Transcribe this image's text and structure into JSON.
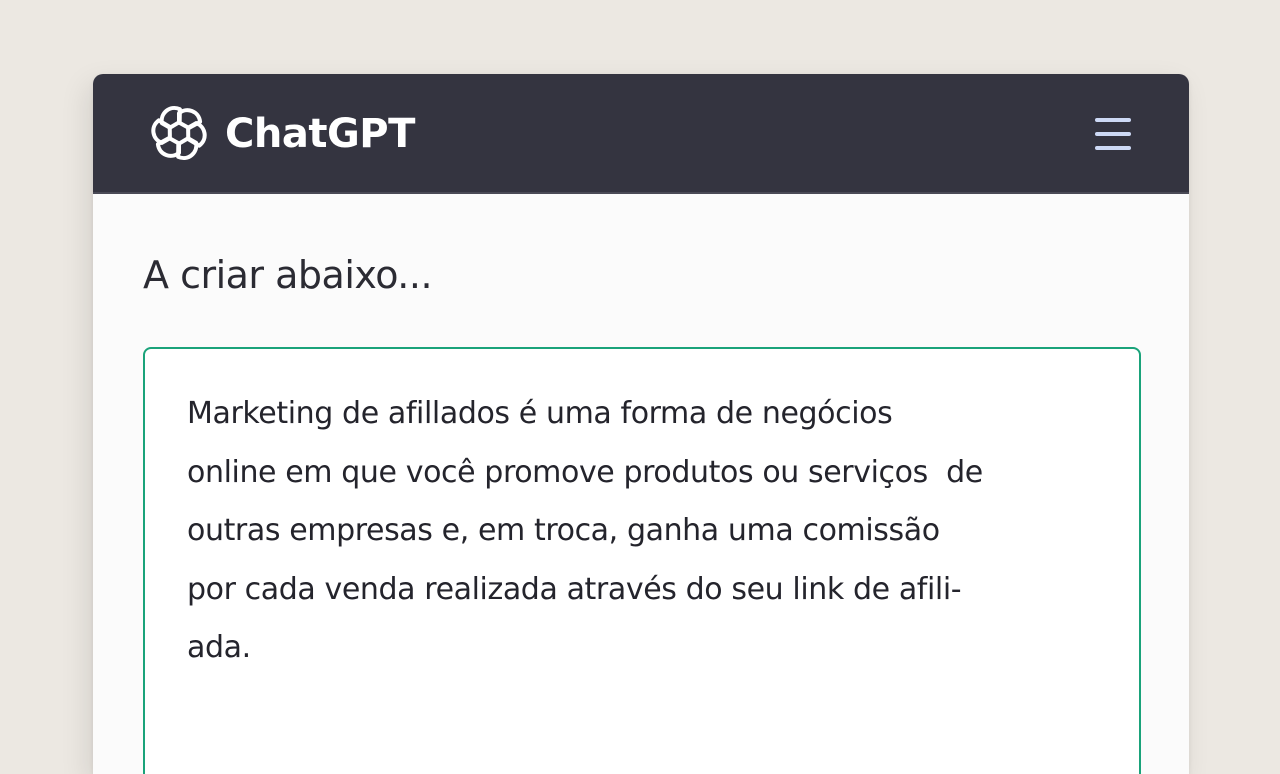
{
  "header": {
    "brand": "ChatGPT",
    "logo_icon": "openai-logo-icon",
    "menu_icon": "hamburger-menu-icon",
    "background_color": "#343440"
  },
  "main": {
    "heading": "A criar abaixo...",
    "response": {
      "border_color": "#1aa37a",
      "paragraphs": [
        {
          "lines": [
            "Marketing de afillados é uma forma de negócios",
            "online em que você promove produtos ou serviços  de",
            "outras empresas e, em troca, ganha uma comissão",
            "por cada venda realizada através do seu link de afili-",
            "ada."
          ]
        }
      ]
    }
  }
}
